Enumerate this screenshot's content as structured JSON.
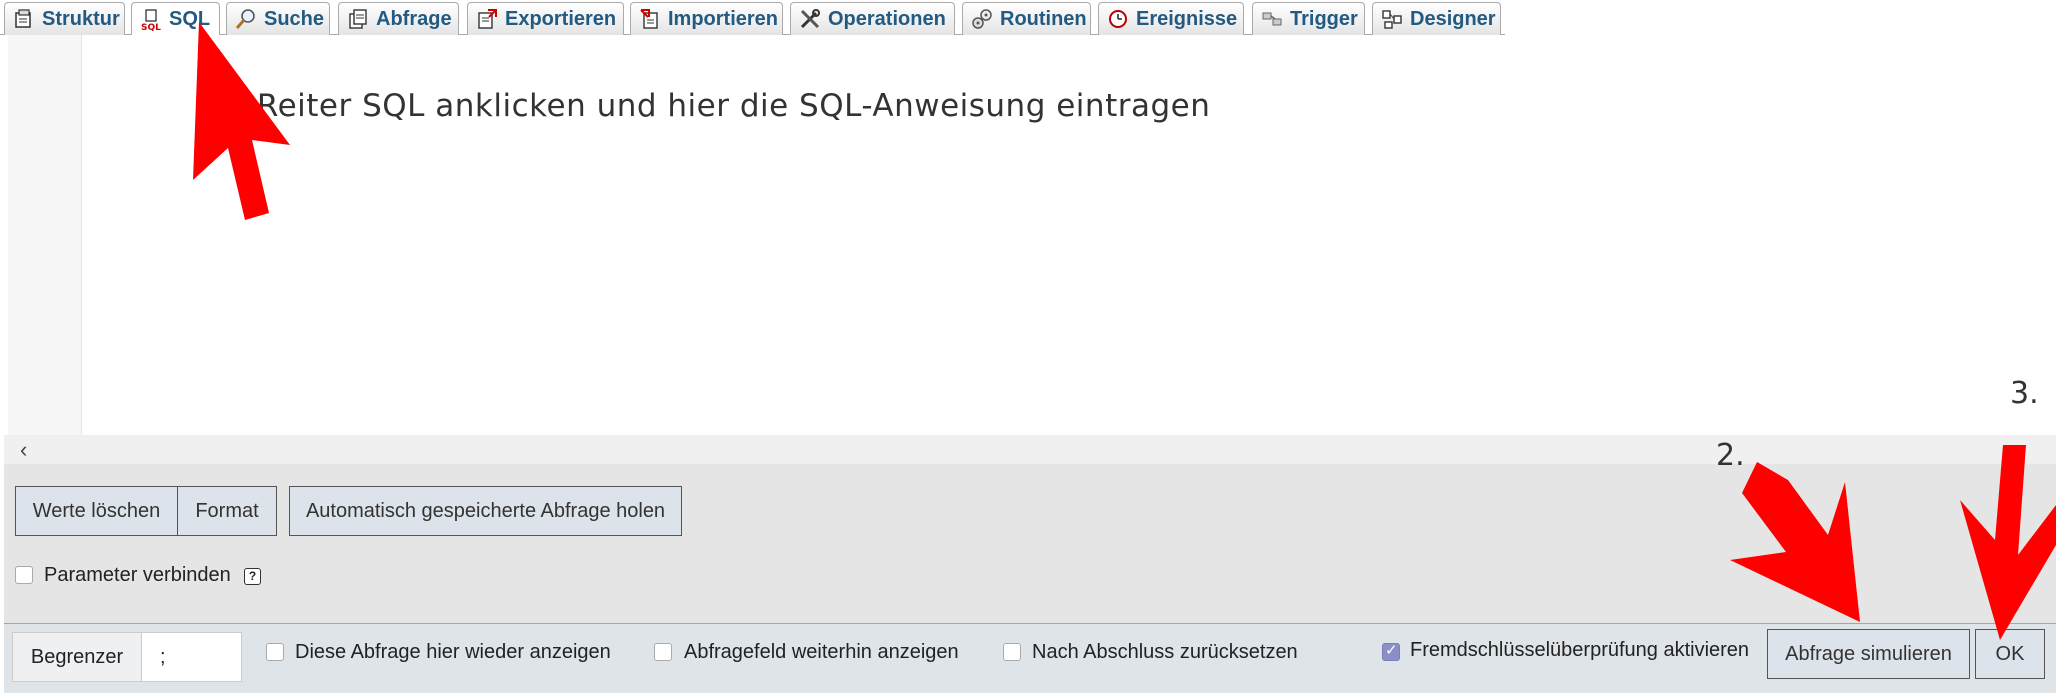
{
  "tabs": [
    {
      "label": "Struktur",
      "icon": "structure-icon"
    },
    {
      "label": "SQL",
      "icon": "sql-icon"
    },
    {
      "label": "Suche",
      "icon": "search-icon"
    },
    {
      "label": "Abfrage",
      "icon": "query-icon"
    },
    {
      "label": "Exportieren",
      "icon": "export-icon"
    },
    {
      "label": "Importieren",
      "icon": "import-icon"
    },
    {
      "label": "Operationen",
      "icon": "operations-icon"
    },
    {
      "label": "Routinen",
      "icon": "routines-icon"
    },
    {
      "label": "Ereignisse",
      "icon": "events-icon"
    },
    {
      "label": "Trigger",
      "icon": "trigger-icon"
    },
    {
      "label": "Designer",
      "icon": "designer-icon"
    }
  ],
  "active_tab": "SQL",
  "annotations": {
    "step1": "1. Reiter SQL anklicken und hier die SQL-Anweisung eintragen",
    "step2": "2.",
    "step3": "3."
  },
  "editor_buttons": {
    "clear": "Werte löschen",
    "format": "Format",
    "autosaved": "Automatisch gespeicherte Abfrage holen"
  },
  "bind_params": {
    "label": "Parameter verbinden",
    "help": "?"
  },
  "footer": {
    "delimiter_label": "Begrenzer",
    "delimiter_value": ";",
    "show_again": "Diese Abfrage hier wieder anzeigen",
    "keep_box": "Abfragefeld weiterhin anzeigen",
    "rollback": "Nach Abschluss zurücksetzen",
    "fk_checks": "Fremdschlüsselüberprüfung aktivieren",
    "simulate": "Abfrage simulieren",
    "ok": "OK"
  },
  "colors": {
    "tab_text": "#235a81",
    "arrow": "#ff0000",
    "checked": "#8a8fc8"
  }
}
